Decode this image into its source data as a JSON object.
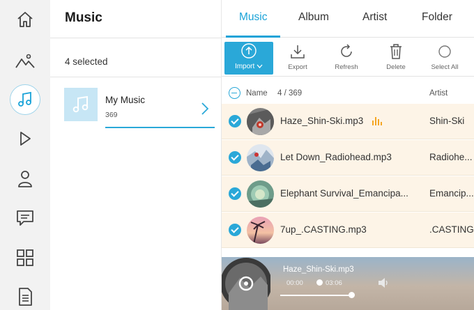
{
  "rail": {
    "items": [
      "home-icon",
      "photos-icon",
      "music-icon",
      "video-icon",
      "contacts-icon",
      "messages-icon",
      "apps-icon",
      "files-icon"
    ],
    "active": "music-icon"
  },
  "sidebar": {
    "title": "Music",
    "selected_text": "4 selected",
    "playlist": {
      "name": "My Music",
      "count": "369"
    }
  },
  "tabs": [
    {
      "label": "Music",
      "active": true
    },
    {
      "label": "Album",
      "active": false
    },
    {
      "label": "Artist",
      "active": false
    },
    {
      "label": "Folder",
      "active": false
    }
  ],
  "toolbar": {
    "import_label": "Import",
    "export_label": "Export",
    "refresh_label": "Refresh",
    "delete_label": "Delete",
    "select_all_label": "Select All"
  },
  "list": {
    "header": {
      "name": "Name",
      "count": "4 / 369",
      "artist": "Artist"
    },
    "rows": [
      {
        "title": "Haze_Shin-Ski.mp3",
        "artist": "Shin-Ski",
        "playing": true,
        "checked": true
      },
      {
        "title": "Let Down_Radiohead.mp3",
        "artist": "Radiohe...",
        "playing": false,
        "checked": true
      },
      {
        "title": "Elephant Survival_Emancipa...",
        "artist": "Emancip...",
        "playing": false,
        "checked": true
      },
      {
        "title": "7up_.CASTING.mp3",
        "artist": ".CASTING",
        "playing": false,
        "checked": true
      }
    ]
  },
  "player": {
    "title": "Haze_Shin-Ski.mp3",
    "elapsed": "00:00",
    "total": "03:06"
  },
  "colors": {
    "accent": "#1aa3d8",
    "row_selected_bg": "#fdf4e7",
    "rail_bg": "#f2f2f2",
    "eq_orange": "#f5a623"
  }
}
